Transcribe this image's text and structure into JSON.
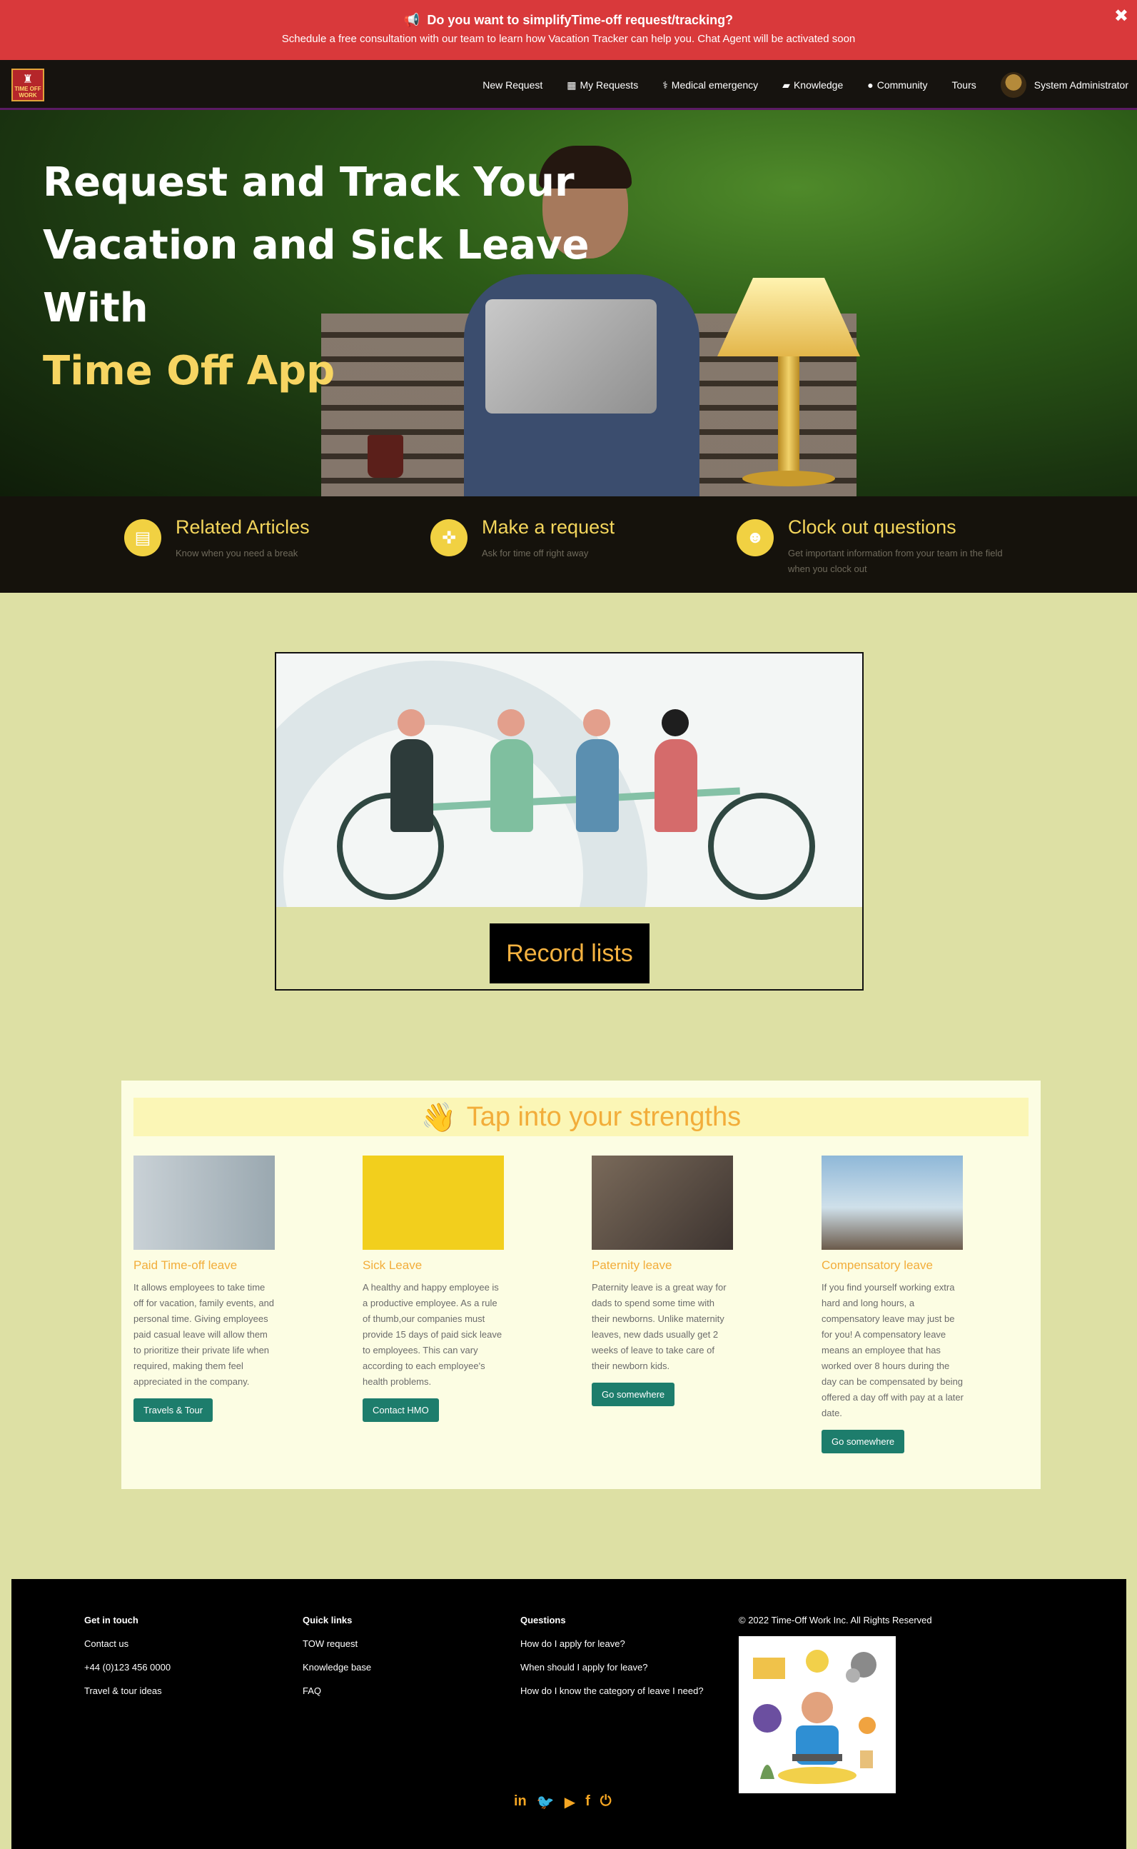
{
  "banner": {
    "headline": "Do you want to simplifyTime-off request/tracking?",
    "subtext": "Schedule a free consultation with our team to learn how Vacation Tracker can help you. Chat Agent will be activated soon",
    "close_symbol": "✖",
    "icon": "megaphone-icon"
  },
  "navbar": {
    "logo_text": "TIME OFF WORK",
    "items": [
      {
        "label": "New Request",
        "icon": ""
      },
      {
        "label": "My Requests",
        "icon": "table-icon"
      },
      {
        "label": "Medical emergency",
        "icon": "stethoscope-icon"
      },
      {
        "label": "Knowledge",
        "icon": "book-icon"
      },
      {
        "label": "Community",
        "icon": "user-icon"
      },
      {
        "label": "Tours",
        "icon": ""
      }
    ],
    "user": "System Administrator"
  },
  "hero": {
    "line1": "Request and Track Your",
    "line2": "Vacation and Sick Leave With",
    "accent": "Time Off App"
  },
  "features": [
    {
      "title": "Related Articles",
      "desc": "Know when you need a break",
      "icon": "book-icon"
    },
    {
      "title": "Make a request",
      "desc": "Ask for time off right away",
      "icon": "crosshair-icon"
    },
    {
      "title": "Clock out questions",
      "desc": "Get important information from your team in the field when you clock out",
      "icon": "user-icon"
    }
  ],
  "record": {
    "button_label": "Record lists"
  },
  "strengths": {
    "heading": "Tap into your strengths",
    "cards": [
      {
        "title": "Paid Time-off leave",
        "text": "It allows employees to take time off for vacation, family events, and personal time. Giving employees paid casual leave will allow them to prioritize their private life when required, making them feel appreciated in the company.",
        "button": "Travels & Tour"
      },
      {
        "title": "Sick Leave",
        "text": "A healthy and happy employee is a productive employee. As a rule of thumb,our companies must provide 15 days of paid sick leave to employees. This can vary according to each employee's health problems.",
        "button": "Contact HMO"
      },
      {
        "title": "Paternity leave",
        "text": "Paternity leave is a great way for dads to spend some time with their newborns. Unlike maternity leaves, new dads usually get 2 weeks of leave to take care of their newborn kids.",
        "button": "Go somewhere"
      },
      {
        "title": "Compensatory leave",
        "text": "If you find yourself working extra hard and long hours, a compensatory leave may just be for you! A compensatory leave means an employee that has worked over 8 hours during the day can be compensated by being offered a day off with pay at a later date.",
        "button": "Go somewhere"
      }
    ]
  },
  "footer": {
    "get_in_touch": {
      "heading": "Get in touch",
      "links": [
        "Contact us",
        "+44 (0)123 456 0000",
        "Travel & tour ideas"
      ]
    },
    "quick_links": {
      "heading": "Quick links",
      "links": [
        "TOW request",
        "Knowledge base",
        "FAQ"
      ]
    },
    "questions": {
      "heading": "Questions",
      "links": [
        "How do I apply for leave?",
        "When should I apply for leave?",
        "How do I know the category of leave I need?"
      ]
    },
    "copyright": "© 2022 Time-Off Work Inc. All Rights Reserved",
    "socials": [
      "linkedin-icon",
      "twitter-icon",
      "youtube-icon",
      "facebook-icon",
      "power-icon"
    ]
  }
}
